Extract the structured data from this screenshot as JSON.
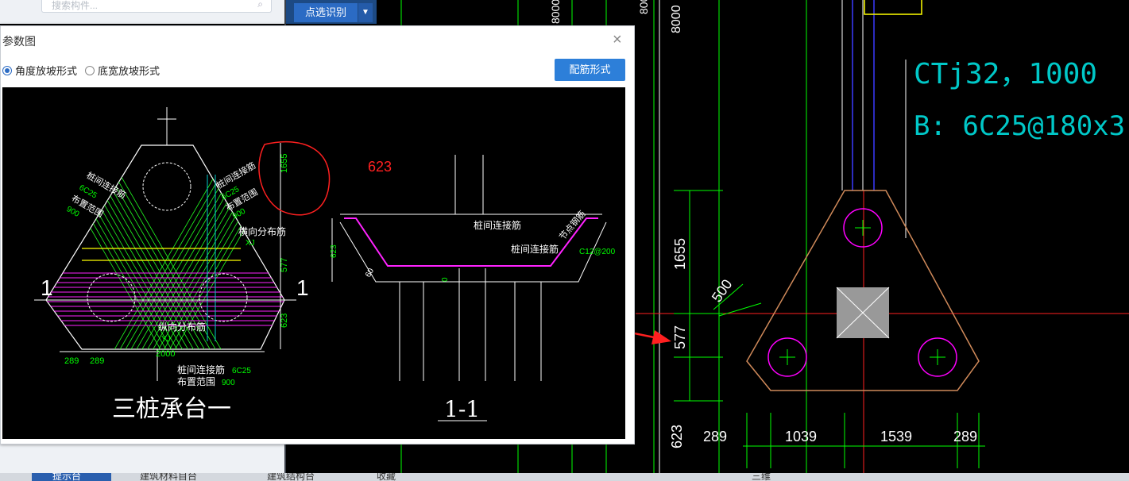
{
  "search": {
    "placeholder": "搜索构件..."
  },
  "toolbar": {
    "pick_label": "点选识别",
    "drop_arrow": "▼"
  },
  "dialog": {
    "title": "参数图",
    "close": "×",
    "radio_angle": "角度放坡形式",
    "radio_width": "底宽放坡形式",
    "selected_radio": "angle",
    "rebar_button": "配筋形式"
  },
  "figure": {
    "plan_title": "三桩承台一",
    "section_title": "1-1",
    "annotation_red": "623",
    "section_mark": "1",
    "labels": {
      "pile_rebar_a": "桩间连接筋",
      "pile_rebar_b": "桩间连接筋",
      "spec_a": "6C25",
      "spec_b": "6C25",
      "range_a": "布置范围",
      "range_b": "布置范围",
      "val_a": "900",
      "val_b": "900",
      "horiz_dist": "横向分布筋",
      "xj": "XJ",
      "long_dist": "纵向分布筋",
      "yj": "YJ",
      "bottom_rebar": "桩间连接筋",
      "bottom_spec": "6C25",
      "bottom_range": "布置范围",
      "bottom_val": "900",
      "sec_rebar": "桩间连接筋",
      "sec_rebar2": "桩间连接筋",
      "node_rebar": "节点钢筋",
      "c12": "C12@200",
      "angle": "60",
      "zero": "0"
    },
    "dims": {
      "d1655": "1655",
      "d577": "577",
      "d623": "623",
      "d2000": "2000",
      "d289a": "289",
      "d289b": "289",
      "d623v": "623"
    }
  },
  "cad": {
    "top_dims": [
      "8000",
      "8000",
      "8000"
    ],
    "label1": "CTj32，1000",
    "label2": "B:  6C25@180x3",
    "v1655": "1655",
    "v577": "577",
    "v623": "623",
    "v500": "500",
    "b289a": "289",
    "b1039": "1039",
    "b1539": "1539",
    "b289b": "289"
  },
  "taskbar": {
    "tab0": "提示台",
    "tab1": "建筑材料目台",
    "tab2": "建筑结构台",
    "tab3": "收藏",
    "tab4": "三维"
  },
  "colors": {
    "accent": "#2d7fd9",
    "cad_green": "#00ff00",
    "cad_pink": "#ff00ff",
    "cad_cyan": "#00c8c8",
    "red_arrow": "#ff2020"
  }
}
